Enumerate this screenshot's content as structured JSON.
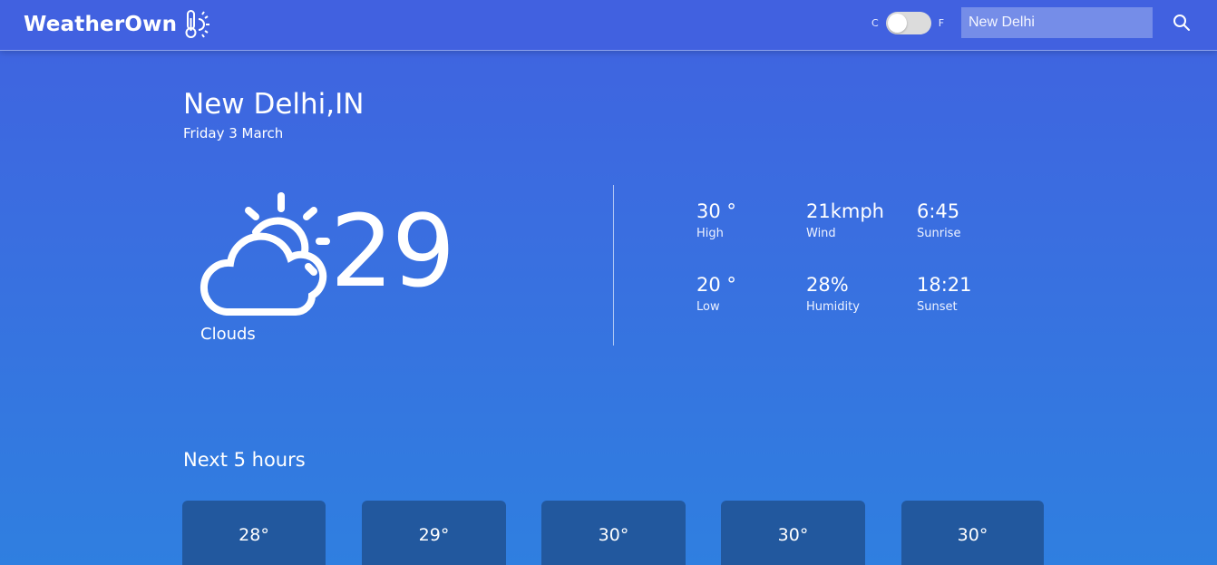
{
  "app": {
    "title": "WeatherOwn"
  },
  "header": {
    "unit_c": "C",
    "unit_f": "F",
    "search_value": "New Delhi",
    "search_placeholder": "New Delhi"
  },
  "location": {
    "city": "New Delhi,IN",
    "date": "Friday 3 March"
  },
  "current": {
    "temp": "29",
    "condition": "Clouds",
    "icon": "cloud-sun-icon"
  },
  "stats": [
    {
      "value": "30 °",
      "label": "High"
    },
    {
      "value": "21kmph",
      "label": "Wind"
    },
    {
      "value": "6:45",
      "label": "Sunrise"
    },
    {
      "value": "20 °",
      "label": "Low"
    },
    {
      "value": "28%",
      "label": "Humidity"
    },
    {
      "value": "18:21",
      "label": "Sunset"
    }
  ],
  "forecast": {
    "title": "Next 5 hours",
    "hours": [
      {
        "temp": "28°"
      },
      {
        "temp": "29°"
      },
      {
        "temp": "30°"
      },
      {
        "temp": "30°"
      },
      {
        "temp": "30°"
      }
    ]
  },
  "colors": {
    "header": "#4161e0",
    "card": "#22589e",
    "text": "#ffffff"
  }
}
